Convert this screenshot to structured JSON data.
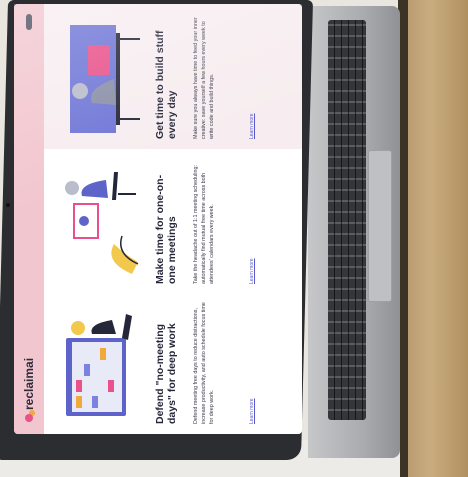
{
  "site": {
    "logo_text": "reclaimai",
    "nav_links": [
      "",
      "",
      "",
      "",
      ""
    ],
    "nav_cta": ""
  },
  "cards": [
    {
      "title": "Defend \"no-meeting days\" for deep work",
      "body": "Defend meeting free days to reduce distractions, increase productivity, and auto schedule focus time for deep work.",
      "link": "Learn more"
    },
    {
      "title": "Make time for one-on-one meetings",
      "body": "Take the headache out of 1:1 meeting scheduling: automatically find mutual free time across both attendees' calendars every week.",
      "link": "Learn more"
    },
    {
      "title": "Get time to build stuff every day",
      "body": "Make sure you always have time to feed your inner creative: save yourself a few hours every week to write code and build things.",
      "link": "Learn more"
    }
  ],
  "colors": {
    "accent_pink": "#e8518a",
    "accent_orange": "#f2a93b",
    "link": "#5a5ad0",
    "bezel": "#2c2d31"
  }
}
